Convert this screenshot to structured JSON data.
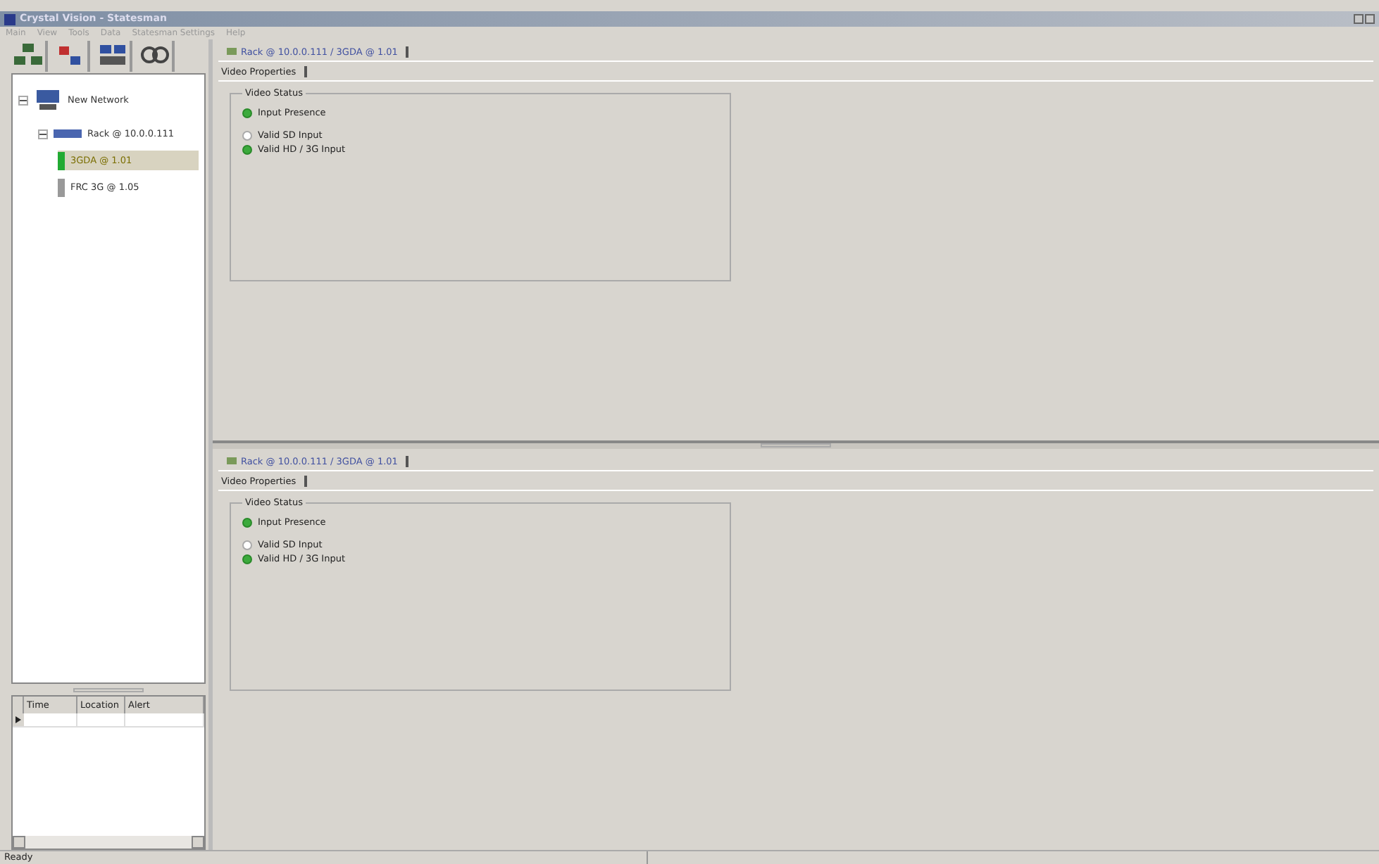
{
  "window": {
    "title": "Crystal Vision - Statesman"
  },
  "menu": [
    "Main",
    "View",
    "Tools",
    "Data",
    "Statesman Settings",
    "Help"
  ],
  "tree": [
    {
      "label": "New Network",
      "kind": "network",
      "expanded": true,
      "selected": false,
      "children": [
        {
          "label": "Rack @ 10.0.0.111",
          "kind": "rack",
          "expanded": true,
          "selected": false,
          "children": [
            {
              "label": "3GDA @ 1.01",
              "kind": "card",
              "selected": true,
              "color": "#22aa33"
            },
            {
              "label": "FRC 3G @ 1.05",
              "kind": "card",
              "selected": false,
              "color": "#999999"
            }
          ]
        }
      ]
    }
  ],
  "alerts": {
    "columns": [
      "Time",
      "Location",
      "Alert"
    ]
  },
  "panes": [
    {
      "tab": "Rack @ 10.0.0.111 / 3GDA @ 1.01",
      "subtab": "Video Properties",
      "group": "Video Status",
      "indicators": [
        {
          "label": "Input Presence",
          "on": true
        },
        {
          "label": "Valid SD Input",
          "on": false
        },
        {
          "label": "Valid HD / 3G Input",
          "on": true
        }
      ]
    },
    {
      "tab": "Rack @ 10.0.0.111 / 3GDA @ 1.01",
      "subtab": "Video Properties",
      "group": "Video Status",
      "indicators": [
        {
          "label": "Input Presence",
          "on": true
        },
        {
          "label": "Valid SD Input",
          "on": false
        },
        {
          "label": "Valid HD / 3G Input",
          "on": true
        }
      ]
    }
  ],
  "status_bar": {
    "text": "Ready"
  }
}
